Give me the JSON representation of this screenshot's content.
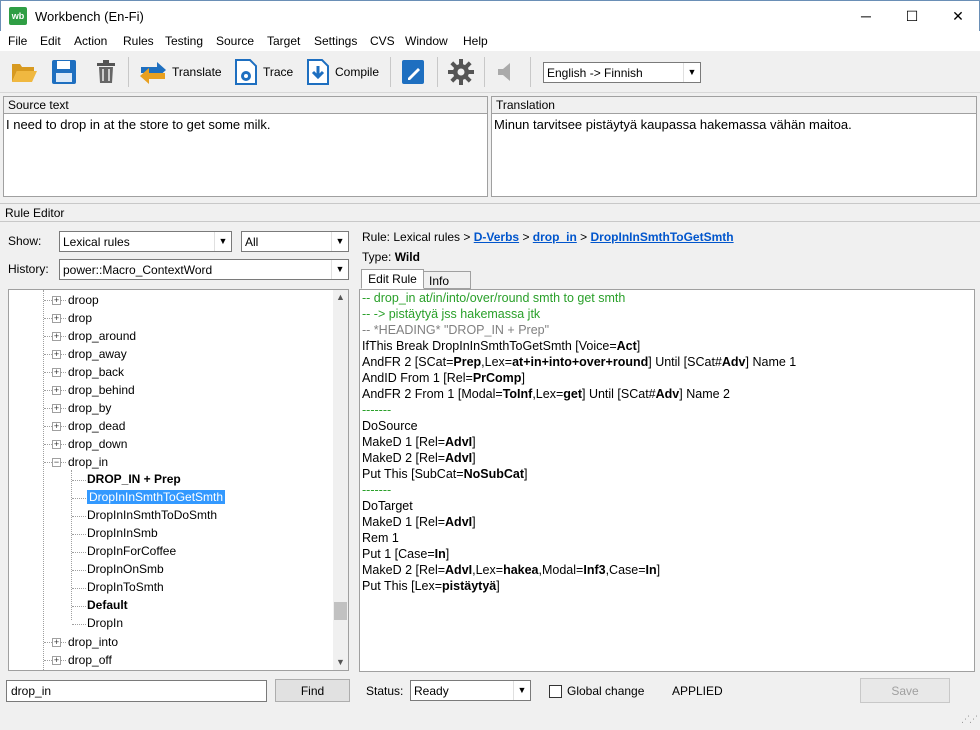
{
  "window": {
    "title": "Workbench (En-Fi)",
    "app_icon_text": "wb",
    "minimize": "─",
    "maximize": "☐",
    "close": "✕"
  },
  "menu": [
    "File",
    "Edit",
    "Action",
    "Rules",
    "Testing",
    "Source",
    "Target",
    "Settings",
    "CVS",
    "Window",
    "Help"
  ],
  "toolbar": {
    "translate": "Translate",
    "trace": "Trace",
    "compile": "Compile",
    "language": "English -> Finnish",
    "icons": [
      "folder-open-icon",
      "save-icon",
      "trash-icon",
      "translate-icon",
      "trace-icon",
      "compile-icon",
      "notebook-icon",
      "gear-icon",
      "speaker-icon"
    ]
  },
  "source_panel": {
    "header": "Source text",
    "text": "I need to drop in at the store to get some milk."
  },
  "translation_panel": {
    "header": "Translation",
    "text": "Minun tarvitsee pistäytyä kaupassa hakemassa vähän maitoa."
  },
  "rule_editor": {
    "header": "Rule Editor",
    "show_label": "Show:",
    "show_value": "Lexical rules",
    "filter_value": "All",
    "history_label": "History:",
    "history_value": "power::Macro_ContextWord",
    "breadcrumb_prefix": "Rule: Lexical rules >",
    "breadcrumb_links": [
      "D-Verbs",
      "drop_in",
      "DropInInSmthToGetSmth"
    ],
    "sep": ">",
    "type_label": "Type:",
    "type_value": "Wild",
    "tabs": [
      "Edit Rule",
      "Info"
    ]
  },
  "tree": {
    "nodes": [
      "droop",
      "drop",
      "drop_around",
      "drop_away",
      "drop_back",
      "drop_behind",
      "drop_by",
      "drop_dead",
      "drop_down",
      "drop_in"
    ],
    "children": [
      "DROP_IN + Prep",
      "DropInInSmthToGetSmth",
      "DropInInSmthToDoSmth",
      "DropInInSmb",
      "DropInForCoffee",
      "DropInOnSmb",
      "DropInToSmth",
      "Default",
      "DropIn"
    ],
    "after": [
      "drop_into",
      "drop_off"
    ]
  },
  "editor_lines": [
    [
      {
        "t": "-- drop_in at/in/into/over/round smth to get smth",
        "c": "green"
      }
    ],
    [
      {
        "t": "-- -> pistäytyä jss hakemassa jtk",
        "c": "green"
      }
    ],
    [
      {
        "t": "-- *HEADING* \"DROP_IN + Prep\"",
        "c": "grey"
      }
    ],
    [
      {
        "t": "IfThis Break DropInInSmthToGetSmth [Voice="
      },
      {
        "t": "Act",
        "b": true
      },
      {
        "t": "]"
      }
    ],
    [
      {
        "t": "AndFR 2 [SCat="
      },
      {
        "t": "Prep",
        "b": true
      },
      {
        "t": ",Lex="
      },
      {
        "t": "at+in+into+over+round",
        "b": true
      },
      {
        "t": "] Until [SCat#"
      },
      {
        "t": "Adv",
        "b": true
      },
      {
        "t": "] Name 1"
      }
    ],
    [
      {
        "t": "AndID From 1 [Rel="
      },
      {
        "t": "PrComp",
        "b": true
      },
      {
        "t": "]"
      }
    ],
    [
      {
        "t": "AndFR 2 From 1 [Modal="
      },
      {
        "t": "ToInf",
        "b": true
      },
      {
        "t": ",Lex="
      },
      {
        "t": "get",
        "b": true
      },
      {
        "t": "] Until [SCat#"
      },
      {
        "t": "Adv",
        "b": true
      },
      {
        "t": "] Name 2"
      }
    ],
    [
      {
        "t": "-------",
        "c": "green"
      }
    ],
    [
      {
        "t": "DoSource"
      }
    ],
    [
      {
        "t": "MakeD 1 [Rel="
      },
      {
        "t": "AdvI",
        "b": true
      },
      {
        "t": "]"
      }
    ],
    [
      {
        "t": "MakeD 2 [Rel="
      },
      {
        "t": "AdvI",
        "b": true
      },
      {
        "t": "]"
      }
    ],
    [
      {
        "t": "Put This [SubCat="
      },
      {
        "t": "NoSubCat",
        "b": true
      },
      {
        "t": "]"
      }
    ],
    [
      {
        "t": "-------",
        "c": "green"
      }
    ],
    [
      {
        "t": "DoTarget"
      }
    ],
    [
      {
        "t": "MakeD 1 [Rel="
      },
      {
        "t": "AdvI",
        "b": true
      },
      {
        "t": "]"
      }
    ],
    [
      {
        "t": "Rem 1"
      }
    ],
    [
      {
        "t": "Put 1 [Case="
      },
      {
        "t": "In",
        "b": true
      },
      {
        "t": "]"
      }
    ],
    [
      {
        "t": "MakeD 2 [Rel="
      },
      {
        "t": "AdvI",
        "b": true
      },
      {
        "t": ",Lex="
      },
      {
        "t": "hakea",
        "b": true
      },
      {
        "t": ",Modal="
      },
      {
        "t": "Inf3",
        "b": true
      },
      {
        "t": ",Case="
      },
      {
        "t": "In",
        "b": true
      },
      {
        "t": "]"
      }
    ],
    [
      {
        "t": "Put This [Lex="
      },
      {
        "t": "pistäytyä",
        "b": true
      },
      {
        "t": "]"
      }
    ]
  ],
  "bottom": {
    "search_value": "drop_in",
    "find": "Find",
    "status_label": "Status:",
    "status_value": "Ready",
    "global_change": "Global change",
    "applied": "APPLIED",
    "save": "Save"
  },
  "colors": {
    "comment_green": "#2aa02a",
    "link_blue": "#0055cc",
    "selection": "#3399ff",
    "icon_blue": "#1e6fc0"
  }
}
